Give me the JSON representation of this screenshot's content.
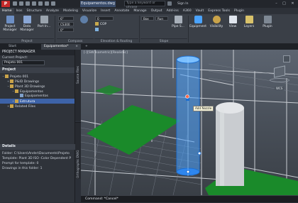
{
  "titlebar": {
    "app_letter": "P",
    "document_title": "Equipamentos.dwg",
    "search_placeholder": "Type a keyword or phrase",
    "sign_in": "Sign In",
    "minimize": "–",
    "maximize": "□",
    "close": "✕"
  },
  "ribbon_tabs": [
    "Home",
    "Isos",
    "Structure",
    "Analyze",
    "Modeling",
    "Visualize",
    "Insert",
    "Annotate",
    "Manage",
    "Output",
    "Add-ins",
    "A360",
    "Vault",
    "Express Tools",
    "Plugin"
  ],
  "active_ribbon_tab_index": 0,
  "ribbon": {
    "project_manager": "Project Manager",
    "data_manager": "Data Manager",
    "part_insert": "Part In...",
    "project_panel": "Project",
    "pipe_size": "6\"",
    "spec": "CS300",
    "value_a": "0\"",
    "value_b": "0",
    "cop": "COP",
    "compass_panel": "Compass",
    "elevation_panel": "Elevation & Routing",
    "box": "Box",
    "run": "Run",
    "pipe_supports": "Pipe S...",
    "slope_panel": "Slope",
    "equipment": "Equipment",
    "visibility": "Visibility",
    "view": "View",
    "layers": "Layers",
    "plugin": "Plugin"
  },
  "file_tabs": [
    "Start",
    "Equipamentos*"
  ],
  "active_file_tab_index": 1,
  "project_manager": {
    "header": "PROJECT MANAGER",
    "current_project_label": "Current Project:",
    "current_project_value": "Projeto 001",
    "project_section": "Project",
    "tree": [
      {
        "label": "Projeto 001",
        "level": 0,
        "type": "folder",
        "expander": "−"
      },
      {
        "label": "P&ID Drawings",
        "level": 1,
        "type": "folder",
        "expander": "+"
      },
      {
        "label": "Plant 3D Drawings",
        "level": 1,
        "type": "folder",
        "expander": "−"
      },
      {
        "label": "Equipamentos",
        "level": 2,
        "type": "folder",
        "expander": "−"
      },
      {
        "label": "Equipamentos",
        "level": 3,
        "type": "doc",
        "expander": ""
      },
      {
        "label": "Estrutura",
        "level": 2,
        "type": "folder",
        "expander": "+"
      },
      {
        "label": "Related Files",
        "level": 1,
        "type": "folder",
        "expander": "+"
      }
    ],
    "selected_tree_index": 5,
    "details_header": "Details",
    "details": [
      "Folder: C:\\Users\\Ander\\Documents\\Projeto",
      "Template: Plant 3D ISO -Color Dependent P",
      "Prompt for template: 0",
      "Drawings in this folder: 1"
    ],
    "side_labels": [
      "Source Files",
      "Orthographic DWG"
    ]
  },
  "viewport": {
    "label": "[-][SW Isometric][Realistic]",
    "tooltip": "Add Nozzle",
    "viewcube_label": "WCS"
  },
  "command_line": "Command: *Cancel*",
  "colors": {
    "accent_blue": "#3d63a8",
    "equipment_blue": "#4aa3ff",
    "floor_green": "#1a8a2a",
    "app_red": "#c62a2a"
  }
}
